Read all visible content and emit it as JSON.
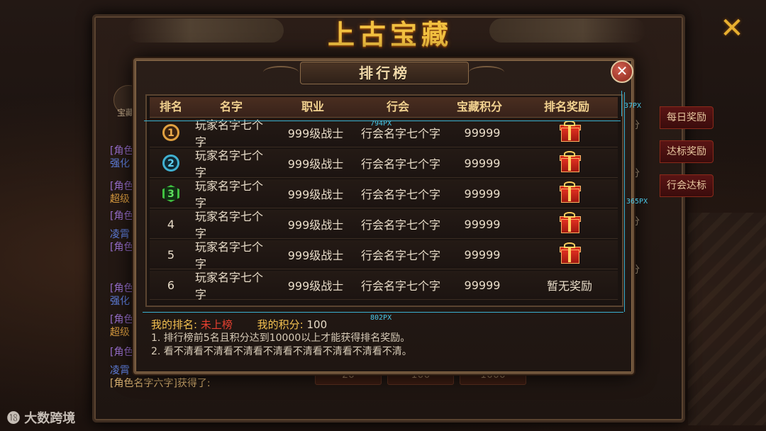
{
  "background": {
    "title": "上古宝藏",
    "tabs": [
      "每日奖励",
      "达标奖励",
      "行会达标"
    ],
    "chat_lines": [
      {
        "text": "[角色",
        "color": "#9a70d0"
      },
      {
        "text": "强化",
        "color": "#6080e0"
      },
      {
        "text": "[角色",
        "color": "#9a70d0"
      },
      {
        "text": "超级",
        "color": "#e0a040"
      },
      {
        "text": "[角色",
        "color": "#9a70d0"
      },
      {
        "text": "凌霄",
        "color": "#6080e0"
      },
      {
        "text": "[角色",
        "color": "#9a70d0"
      }
    ],
    "chat_lines_2": [
      {
        "text": "[角色",
        "color": "#9a70d0"
      },
      {
        "text": "强化",
        "color": "#6080e0"
      },
      {
        "text": "[角色",
        "color": "#9a70d0"
      },
      {
        "text": "超级",
        "color": "#e0a040"
      },
      {
        "text": "[角色",
        "color": "#9a70d0"
      },
      {
        "text": "凌霄",
        "color": "#6080e0"
      }
    ],
    "chat_last": "[角色名字六字]获得了:",
    "right_texts": [
      "分",
      "分",
      "分",
      "分"
    ],
    "bottom_buttons": [
      "20",
      "100",
      "1000"
    ],
    "left_badge": "宝藏"
  },
  "modal": {
    "title": "排行榜",
    "close_label": "✕",
    "columns": [
      "排名",
      "名字",
      "职业",
      "行会",
      "宝藏积分",
      "排名奖励"
    ],
    "rows": [
      {
        "rank": "1",
        "name": "玩家名字七个字",
        "job": "999级战士",
        "guild": "行会名字七个字",
        "score": "99999",
        "reward": "gift"
      },
      {
        "rank": "2",
        "name": "玩家名字七个字",
        "job": "999级战士",
        "guild": "行会名字七个字",
        "score": "99999",
        "reward": "gift"
      },
      {
        "rank": "3",
        "name": "玩家名字七个字",
        "job": "999级战士",
        "guild": "行会名字七个字",
        "score": "99999",
        "reward": "gift"
      },
      {
        "rank": "4",
        "name": "玩家名字七个字",
        "job": "999级战士",
        "guild": "行会名字七个字",
        "score": "99999",
        "reward": "gift"
      },
      {
        "rank": "5",
        "name": "玩家名字七个字",
        "job": "999级战士",
        "guild": "行会名字七个字",
        "score": "99999",
        "reward": "gift"
      },
      {
        "rank": "6",
        "name": "玩家名字七个字",
        "job": "999级战士",
        "guild": "行会名字七个字",
        "score": "99999",
        "reward": "暂无奖励"
      }
    ],
    "my_rank_label": "我的排名:",
    "my_rank_value": "未上榜",
    "my_score_label": "我的积分:",
    "my_score_value": "100",
    "notes": [
      "1. 排行榜前5名且积分达到10000以上才能获得排名奖励。",
      "2. 看不清看不清看不清看不清看不清看不清看不清看不清。"
    ]
  },
  "annotations": {
    "w1": "794PX",
    "w2": "802PX",
    "h1": "37PX",
    "h2": "365PX"
  },
  "watermark": "大数跨境"
}
